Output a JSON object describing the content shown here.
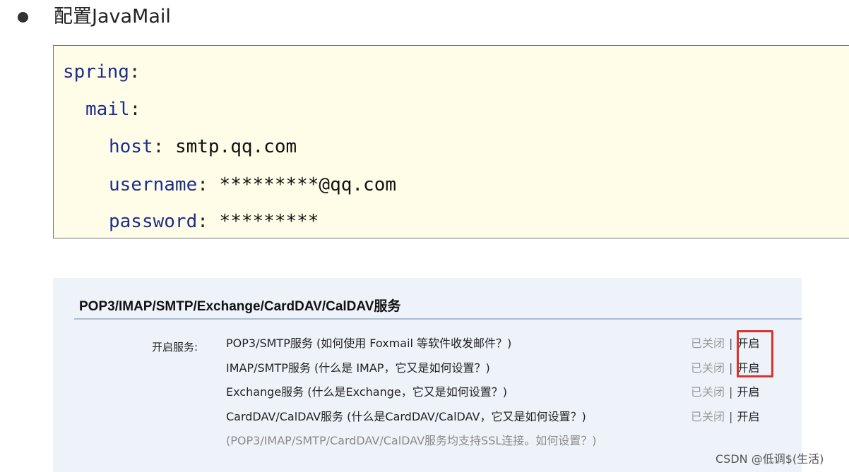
{
  "heading": {
    "text": "配置JavaMail"
  },
  "code": {
    "line1_key": "spring",
    "line2_key": "mail",
    "line3_key": "host",
    "line3_val": "smtp.qq.com",
    "line4_key": "username",
    "line4_val": "*********@qq.com",
    "line5_key": "password",
    "line5_val": "*********",
    "colon": ":"
  },
  "panel": {
    "title": "POP3/IMAP/SMTP/Exchange/CardDAV/CalDAV服务",
    "service_label": "开启服务:",
    "services": [
      {
        "name": "POP3/SMTP服务",
        "help": "(如何使用 Foxmail 等软件收发邮件？)",
        "status_closed": "已关闭",
        "sep": "|",
        "status_open": "开启"
      },
      {
        "name": "IMAP/SMTP服务",
        "help": "(什么是 IMAP，它又是如何设置？)",
        "status_closed": "已关闭",
        "sep": "|",
        "status_open": "开启"
      },
      {
        "name": "Exchange服务",
        "help": "(什么是Exchange，它又是如何设置？)",
        "status_closed": "已关闭",
        "sep": "|",
        "status_open": "开启"
      },
      {
        "name": "CardDAV/CalDAV服务",
        "help": "(什么是CardDAV/CalDAV，它又是如何设置？)",
        "status_closed": "已关闭",
        "sep": "|",
        "status_open": "开启"
      }
    ],
    "ssl_note": "(POP3/IMAP/SMTP/CardDAV/CalDAV服务均支持SSL连接。如何设置？)"
  },
  "watermark": "CSDN @低调$(生活)",
  "colors": {
    "code_bg": "#fffde8",
    "code_key": "#1b2f8a",
    "panel_bg": "#eef3fa",
    "highlight": "#d9312b",
    "status_closed": "#9a9a9a"
  }
}
